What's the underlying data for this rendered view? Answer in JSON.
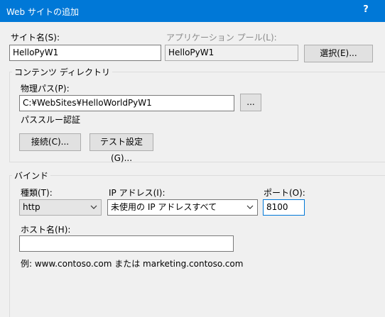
{
  "window": {
    "title": "Web サイトの追加",
    "help_label": "?"
  },
  "site": {
    "site_name_label": "サイト名(S):",
    "site_name_value": "HelloPyW1",
    "app_pool_label": "アプリケーション プール(L):",
    "app_pool_value": "HelloPyW1",
    "select_button_label": "選択(E)..."
  },
  "content_directory": {
    "group_title": "コンテンツ ディレクトリ",
    "physical_path_label": "物理パス(P):",
    "physical_path_value": "C:¥WebSites¥HelloWorldPyW1",
    "browse_button_label": "...",
    "passthrough_label": "パススルー認証",
    "connect_button_label": "接続(C)...",
    "test_settings_button_label": "テスト設定(G)..."
  },
  "binding": {
    "group_title": "バインド",
    "type_label": "種類(T):",
    "type_value": "http",
    "ip_label": "IP アドレス(I):",
    "ip_value": "未使用の IP アドレスすべて",
    "port_label": "ポート(O):",
    "port_value": "8100",
    "host_label": "ホスト名(H):",
    "host_value": "",
    "example_text": "例: www.contoso.com または marketing.contoso.com"
  },
  "colors": {
    "titlebar": "#0078d7",
    "window_bg": "#f0f0f0",
    "focus_border": "#0078d7"
  }
}
